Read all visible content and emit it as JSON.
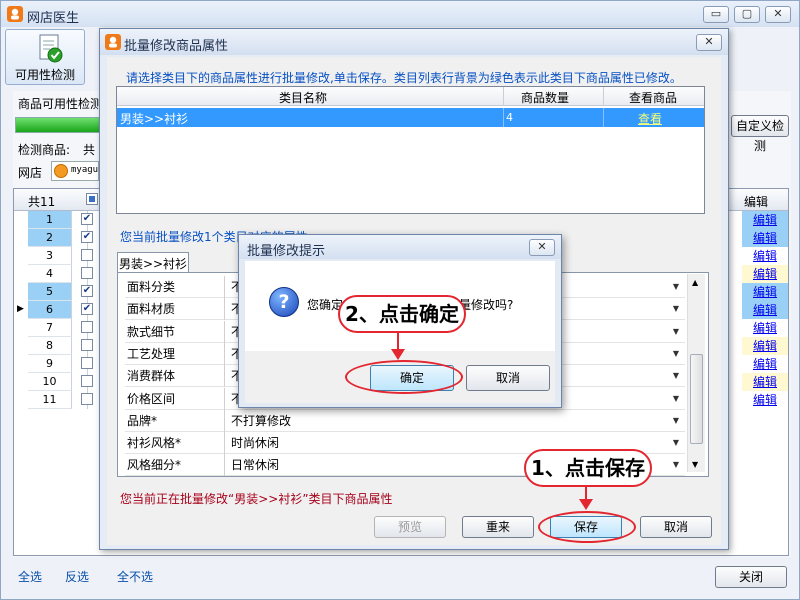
{
  "window": {
    "title": "网店医生",
    "min": "▭",
    "max": "▢",
    "close": "✕"
  },
  "toolbar": {
    "check_button": "可用性检测"
  },
  "main": {
    "check_label": "商品可用性检测",
    "progress_percent": 100,
    "goods_label": "检测商品:",
    "goods_value": "共",
    "shop_label": "网店",
    "shop_value": "myagu",
    "custom_check_button": "自定义检测",
    "count_header": "共11",
    "edit_header": "编辑",
    "rows": [
      {
        "num": "1",
        "checked": true,
        "selected": true,
        "edit": "编辑",
        "color": "b"
      },
      {
        "num": "2",
        "checked": true,
        "selected": true,
        "edit": "编辑",
        "color": "b"
      },
      {
        "num": "3",
        "checked": false,
        "selected": false,
        "edit": "编辑",
        "color": ""
      },
      {
        "num": "4",
        "checked": false,
        "selected": false,
        "edit": "编辑",
        "color": "y"
      },
      {
        "num": "5",
        "checked": true,
        "selected": true,
        "edit": "编辑",
        "color": "b"
      },
      {
        "num": "6",
        "checked": true,
        "selected": true,
        "edit": "编辑",
        "color": "b",
        "current": true
      },
      {
        "num": "7",
        "checked": false,
        "selected": false,
        "edit": "编辑",
        "color": ""
      },
      {
        "num": "8",
        "checked": false,
        "selected": false,
        "edit": "编辑",
        "color": "y"
      },
      {
        "num": "9",
        "checked": false,
        "selected": false,
        "edit": "编辑",
        "color": ""
      },
      {
        "num": "10",
        "checked": false,
        "selected": false,
        "edit": "编辑",
        "color": "y"
      },
      {
        "num": "11",
        "checked": false,
        "selected": false,
        "edit": "编辑",
        "color": ""
      }
    ],
    "select_all": "全选",
    "invert": "反选",
    "select_none": "全不选",
    "close_button": "关闭"
  },
  "batch_dialog": {
    "title": "批量修改商品属性",
    "close": "✕",
    "instruction": "请选择类目下的商品属性进行批量修改,单击保存。类目列表行背景为绿色表示此类目下商品属性已修改。",
    "columns": [
      "类目名称",
      "商品数量",
      "查看商品"
    ],
    "category_row": {
      "name": "男装>>衬衫",
      "count": "4",
      "view": "查看"
    },
    "modify_note": "您当前批量修改1个类目对应的属性",
    "tab": "男装>>衬衫",
    "properties": [
      {
        "name": "面料分类",
        "value": "不"
      },
      {
        "name": "面料材质",
        "value": "不"
      },
      {
        "name": "款式细节",
        "value": "不"
      },
      {
        "name": "工艺处理",
        "value": "不"
      },
      {
        "name": "消费群体",
        "value": "不"
      },
      {
        "name": "价格区间",
        "value": "不"
      },
      {
        "name": "品牌*",
        "value": "不打算修改"
      },
      {
        "name": "衬衫风格*",
        "value": "时尚休闲"
      },
      {
        "name": "风格细分*",
        "value": "日常休闲"
      }
    ],
    "status_note": "您当前正在批量修改“男装>>衬衫”类目下商品属性",
    "preview": "预览",
    "reset": "重来",
    "save": "保存",
    "cancel": "取消"
  },
  "confirm_dialog": {
    "title": "批量修改提示",
    "close": "✕",
    "message_start": "您确定",
    "message_end": "量修改吗?",
    "ok": "确定",
    "cancel": "取消"
  },
  "annotations": {
    "step1": "1、点击保存",
    "step2": "2、点击确定"
  },
  "colors": {
    "accent": "#e3262f",
    "selection": "#3399ff",
    "link": "#0000ee"
  }
}
